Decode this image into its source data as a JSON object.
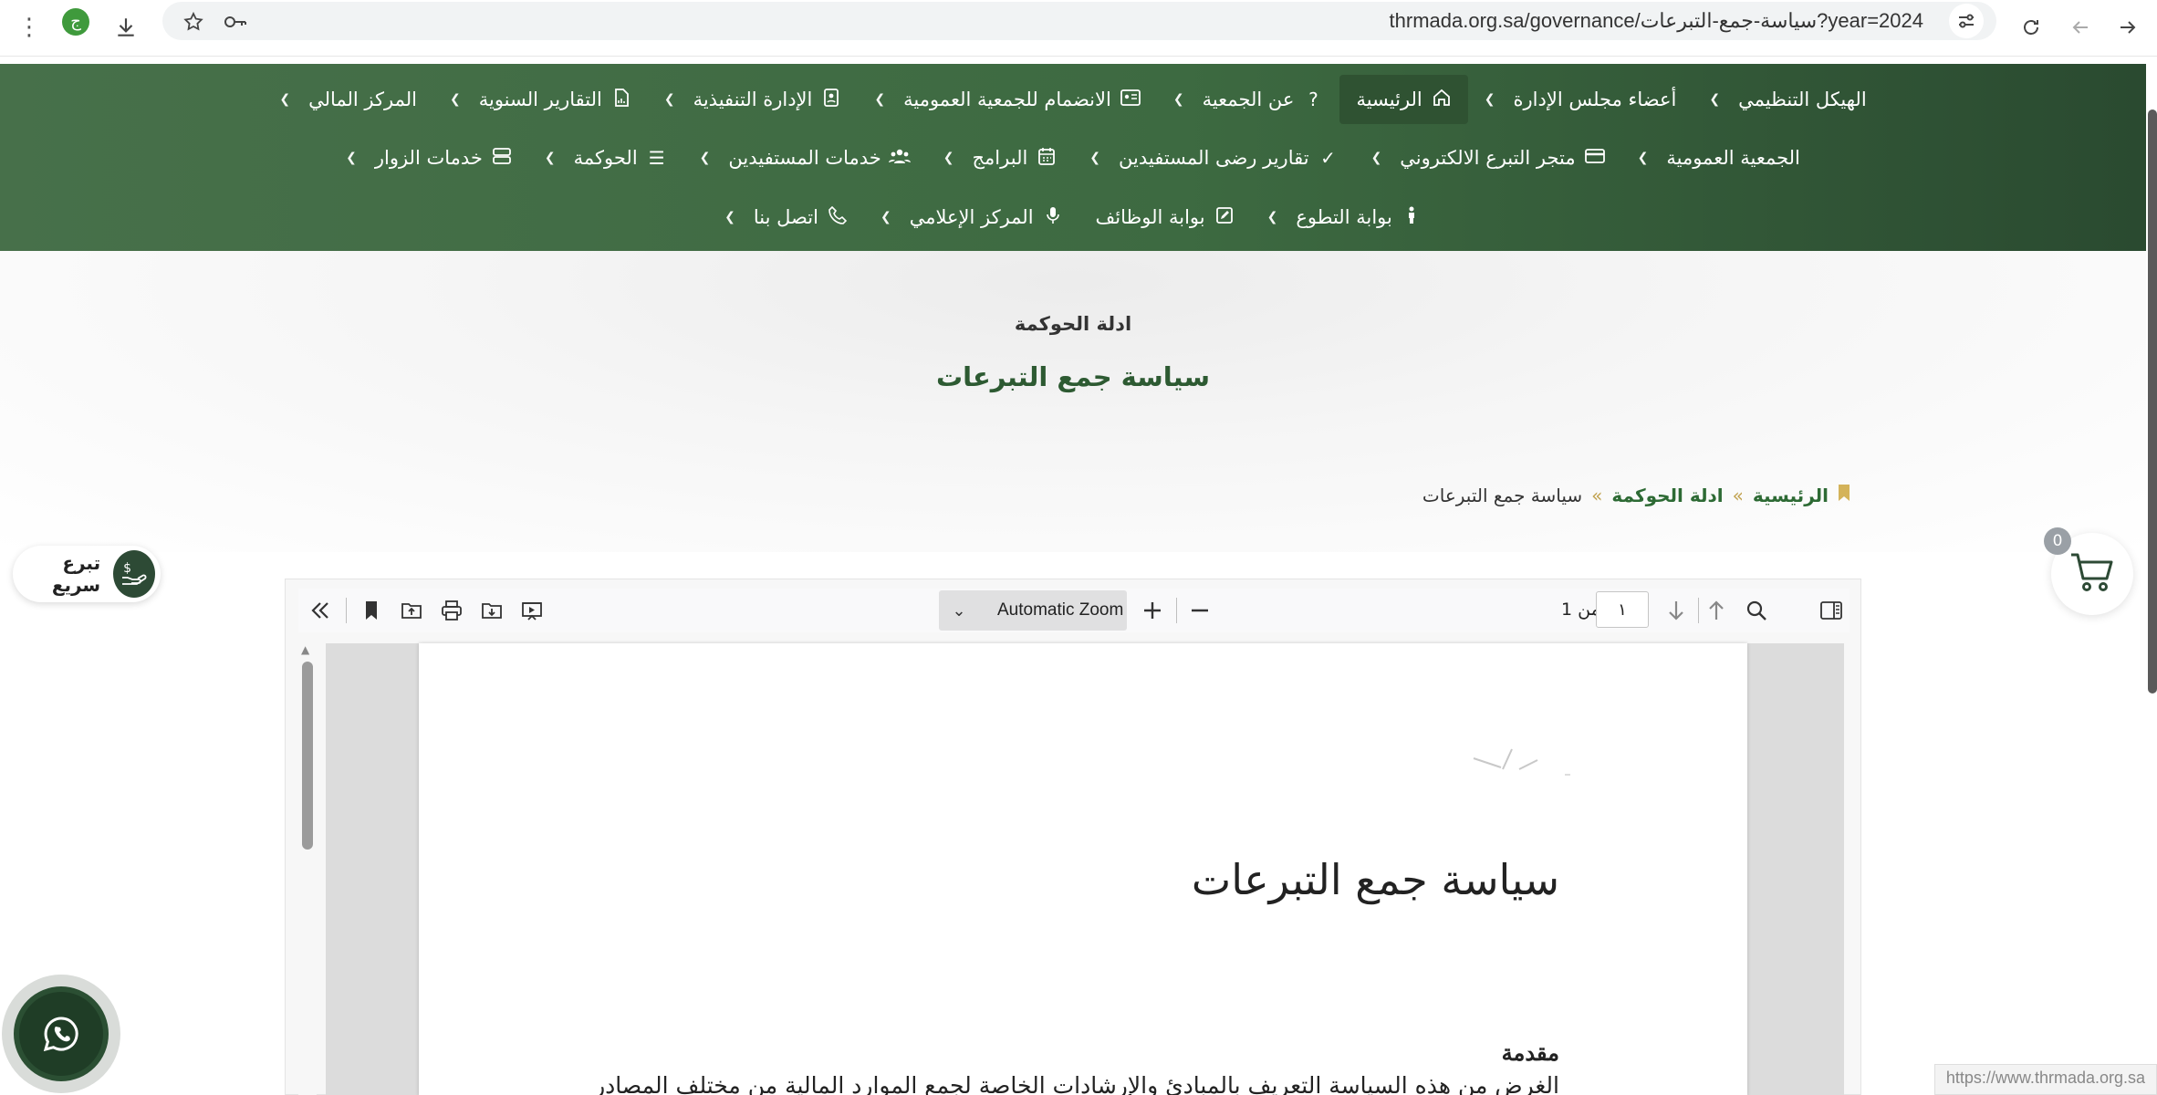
{
  "browser": {
    "url": "thrmada.org.sa/governance/سياسة-جمع-التبرعات?year=2024",
    "profile_initial": "ج",
    "status_url": "https://www.thrmada.org.sa"
  },
  "nav": {
    "row1": [
      {
        "label": "الهيكل التنظيمي",
        "icon": "",
        "has_chevron": true
      },
      {
        "label": "أعضاء مجلس الإدارة",
        "icon": "",
        "has_chevron": true
      },
      {
        "label": "الرئيسية",
        "icon": "home-icon",
        "has_chevron": false
      },
      {
        "label": "عن الجمعية",
        "icon": "question-icon",
        "has_chevron": true
      },
      {
        "label": "الانضمام للجمعية العمومية",
        "icon": "id-card-icon",
        "has_chevron": true
      },
      {
        "label": "الإدارة التنفيذية",
        "icon": "address-book-icon",
        "has_chevron": true
      },
      {
        "label": "التقارير السنوية",
        "icon": "file-chart-icon",
        "has_chevron": true
      },
      {
        "label": "المركز المالي",
        "icon": "",
        "has_chevron": true
      }
    ],
    "row2": [
      {
        "label": "الجمعية العمومية",
        "icon": "",
        "has_chevron": true
      },
      {
        "label": "متجر التبرع الالكتروني",
        "icon": "credit-card-icon",
        "has_chevron": true
      },
      {
        "label": "تقارير رضى المستفيدين",
        "icon": "check-icon",
        "has_chevron": true
      },
      {
        "label": "البرامج",
        "icon": "calendar-icon",
        "has_chevron": true
      },
      {
        "label": "خدمات المستفيدين",
        "icon": "users-icon",
        "has_chevron": true
      },
      {
        "label": "الحوكمة",
        "icon": "list-icon",
        "has_chevron": true
      },
      {
        "label": "خدمات الزوار",
        "icon": "server-icon",
        "has_chevron": true
      }
    ],
    "row3": [
      {
        "label": "بوابة التطوع",
        "icon": "person-icon",
        "has_chevron": true
      },
      {
        "label": "بوابة الوظائف",
        "icon": "edit-square-icon",
        "has_chevron": false
      },
      {
        "label": "المركز الإعلامي",
        "icon": "microphone-icon",
        "has_chevron": true
      },
      {
        "label": "اتصل بنا",
        "icon": "phone-icon",
        "has_chevron": true
      }
    ]
  },
  "hero": {
    "kicker": "ادلة الحوكمة",
    "title": "سياسة جمع التبرعات"
  },
  "breadcrumb": {
    "home": "الرئيسية",
    "section": "ادلة الحوكمة",
    "current": "سياسة جمع التبرعات",
    "separator": "»"
  },
  "quick_donate": {
    "label": "تبرع سريع"
  },
  "cart": {
    "count": "0"
  },
  "pdf_viewer": {
    "zoom_label": "Automatic Zoom",
    "page_number": "١",
    "page_of": "من 1",
    "document": {
      "title": "سياسة جمع التبرعات",
      "heading": "مقدمة",
      "first_line": "الغرض من هذه السياسة التعريف بالمبادئ والإرشادات الخاصة لجمع الموارد المالية من مختلف المصادر"
    }
  },
  "colors": {
    "nav_green": "#3d6a41",
    "nav_active": "#2f5232",
    "title_green": "#2d5a32",
    "breadcrumb_link": "#2d6a34",
    "bookmark_gold": "#d4b35a",
    "whatsapp_bg": "#1f3d26"
  }
}
